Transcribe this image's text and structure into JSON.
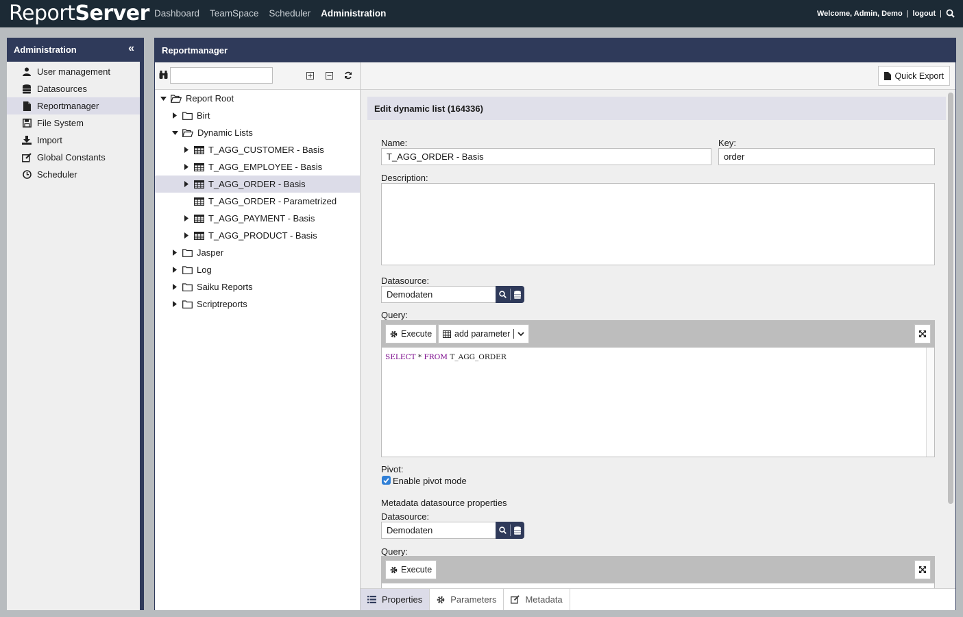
{
  "brand": {
    "name_light": "Report",
    "name_bold": "Server"
  },
  "nav": {
    "items": [
      "Dashboard",
      "TeamSpace",
      "Scheduler",
      "Administration"
    ],
    "active": "Administration"
  },
  "user": {
    "welcome": "Welcome, Admin, Demo",
    "separator": "|",
    "logout": "logout"
  },
  "admin": {
    "title": "Administration",
    "items": [
      {
        "label": "User management",
        "icon": "user-icon"
      },
      {
        "label": "Datasources",
        "icon": "database-icon"
      },
      {
        "label": "Reportmanager",
        "icon": "file-icon"
      },
      {
        "label": "File System",
        "icon": "save-icon"
      },
      {
        "label": "Import",
        "icon": "download-icon"
      },
      {
        "label": "Global Constants",
        "icon": "edit-icon"
      },
      {
        "label": "Scheduler",
        "icon": "clock-icon"
      }
    ],
    "selected": "Reportmanager"
  },
  "main": {
    "title": "Reportmanager"
  },
  "tree": {
    "search_value": "",
    "nodes": [
      {
        "label": "Report Root",
        "type": "folder-open"
      },
      {
        "label": "Birt",
        "type": "folder"
      },
      {
        "label": "Dynamic Lists",
        "type": "folder-open"
      },
      {
        "label": "T_AGG_CUSTOMER - Basis",
        "type": "table"
      },
      {
        "label": "T_AGG_EMPLOYEE - Basis",
        "type": "table"
      },
      {
        "label": "T_AGG_ORDER - Basis",
        "type": "table"
      },
      {
        "label": "T_AGG_ORDER - Parametrized",
        "type": "table"
      },
      {
        "label": "T_AGG_PAYMENT - Basis",
        "type": "table"
      },
      {
        "label": "T_AGG_PRODUCT - Basis",
        "type": "table"
      },
      {
        "label": "Jasper",
        "type": "folder"
      },
      {
        "label": "Log",
        "type": "folder"
      },
      {
        "label": "Saiku Reports",
        "type": "folder"
      },
      {
        "label": "Scriptreports",
        "type": "folder"
      }
    ],
    "selected": "T_AGG_ORDER - Basis"
  },
  "toolbar": {
    "quick_export": "Quick Export"
  },
  "form": {
    "title": "Edit dynamic list (164336)",
    "name_label": "Name:",
    "name_value": "T_AGG_ORDER - Basis",
    "key_label": "Key:",
    "key_value": "order",
    "description_label": "Description:",
    "description_value": "",
    "datasource_label": "Datasource:",
    "datasource_value": "Demodaten",
    "query_label": "Query:",
    "execute_label": "Execute",
    "add_parameter_label": "add parameter",
    "query_code": {
      "select": "SELECT",
      "star": " * ",
      "from": "FROM",
      "table": " T_AGG_ORDER"
    },
    "pivot_label": "Pivot:",
    "pivot_checkbox_label": "Enable pivot mode",
    "pivot_enabled": true,
    "metadata_heading": "Metadata datasource properties",
    "meta_datasource_label": "Datasource:",
    "meta_datasource_value": "Demodaten",
    "meta_query_label": "Query:",
    "meta_execute_label": "Execute"
  },
  "tabs": [
    {
      "label": "Properties",
      "icon": "list-icon"
    },
    {
      "label": "Parameters",
      "icon": "gear-icon"
    },
    {
      "label": "Metadata",
      "icon": "edit-icon"
    }
  ],
  "colors": {
    "header_bg": "#1c2a35",
    "panel_header": "#2f3a5a",
    "selection": "#dcdce8",
    "accent": "#2f7fd6"
  }
}
